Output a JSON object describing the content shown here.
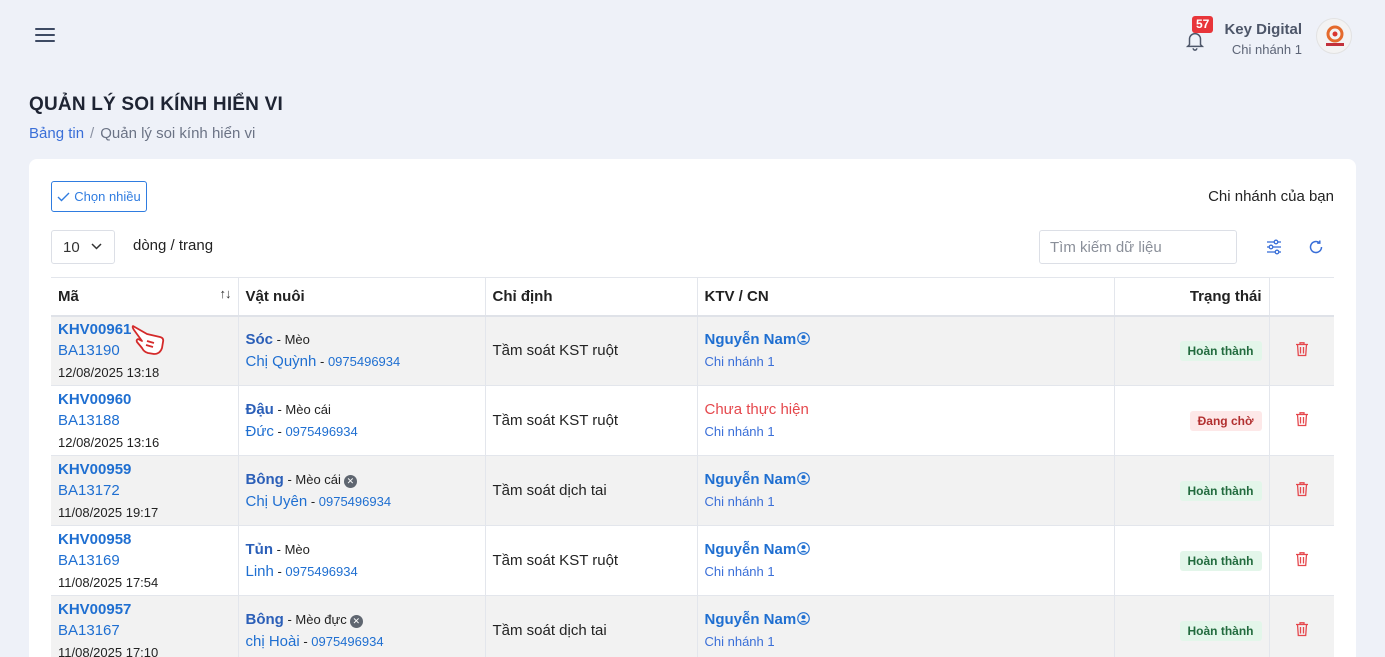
{
  "header": {
    "notifications_count": "57",
    "user_name": "Key Digital",
    "user_branch": "Chi nhánh 1"
  },
  "page": {
    "title": "QUẢN LÝ SOI KÍNH HIỂN VI",
    "breadcrumb": [
      "Bảng tin",
      "Quản lý soi kính hiển vi"
    ]
  },
  "toolbar": {
    "select_multiple_label": "Chọn nhiều",
    "branch_label": "Chi nhánh của bạn",
    "page_size": "10",
    "per_page_label": "dòng / trang",
    "search_placeholder": "Tìm kiếm dữ liệu"
  },
  "table": {
    "columns": [
      "Mã",
      "Vật nuôi",
      "Chỉ định",
      "KTV / CN",
      "Trạng thái"
    ],
    "rows": [
      {
        "code": "KHV00961",
        "ba": "BA13190",
        "datetime": "12/08/2025 13:18",
        "pet_name": "Sóc",
        "pet_type": "Mèo",
        "pet_x": false,
        "owner": "Chị Quỳnh",
        "phone": "0975496934",
        "indication": "Tầm soát KST ruột",
        "tech": "Nguyễn Nam",
        "tech_pending": false,
        "tech_branch": "Chi nhánh 1",
        "status": "Hoàn thành",
        "status_kind": "done"
      },
      {
        "code": "KHV00960",
        "ba": "BA13188",
        "datetime": "12/08/2025 13:16",
        "pet_name": "Đậu",
        "pet_type": "Mèo cái",
        "pet_x": false,
        "owner": "Đức",
        "phone": "0975496934",
        "indication": "Tầm soát KST ruột",
        "tech": "Chưa thực hiện",
        "tech_pending": true,
        "tech_branch": "Chi nhánh 1",
        "status": "Đang chờ",
        "status_kind": "wait"
      },
      {
        "code": "KHV00959",
        "ba": "BA13172",
        "datetime": "11/08/2025 19:17",
        "pet_name": "Bông",
        "pet_type": "Mèo cái",
        "pet_x": true,
        "owner": "Chị Uyên",
        "phone": "0975496934",
        "indication": "Tầm soát dịch tai",
        "tech": "Nguyễn Nam",
        "tech_pending": false,
        "tech_branch": "Chi nhánh 1",
        "status": "Hoàn thành",
        "status_kind": "done"
      },
      {
        "code": "KHV00958",
        "ba": "BA13169",
        "datetime": "11/08/2025 17:54",
        "pet_name": "Tủn",
        "pet_type": "Mèo",
        "pet_x": false,
        "owner": "Linh",
        "phone": "0975496934",
        "indication": "Tầm soát KST ruột",
        "tech": "Nguyễn Nam",
        "tech_pending": false,
        "tech_branch": "Chi nhánh 1",
        "status": "Hoàn thành",
        "status_kind": "done"
      },
      {
        "code": "KHV00957",
        "ba": "BA13167",
        "datetime": "11/08/2025 17:10",
        "pet_name": "Bông",
        "pet_type": "Mèo đực",
        "pet_x": true,
        "owner": "chị Hoài",
        "phone": "0975496934",
        "indication": "Tầm soát dịch tai",
        "tech": "Nguyễn Nam",
        "tech_pending": false,
        "tech_branch": "Chi nhánh 1",
        "status": "Hoàn thành",
        "status_kind": "done"
      }
    ]
  },
  "colors": {
    "accent": "#1f6fd1",
    "badge_done_bg": "#e3f6ea",
    "badge_wait_bg": "#fde8e8",
    "danger": "#e5484d"
  },
  "icons": [
    "menu-icon",
    "bell-icon",
    "check-icon",
    "chevron-down-icon",
    "sort-icon",
    "filter-icon",
    "refresh-icon",
    "user-icon",
    "x-circle-icon",
    "trash-icon",
    "pointer-hand-icon"
  ]
}
